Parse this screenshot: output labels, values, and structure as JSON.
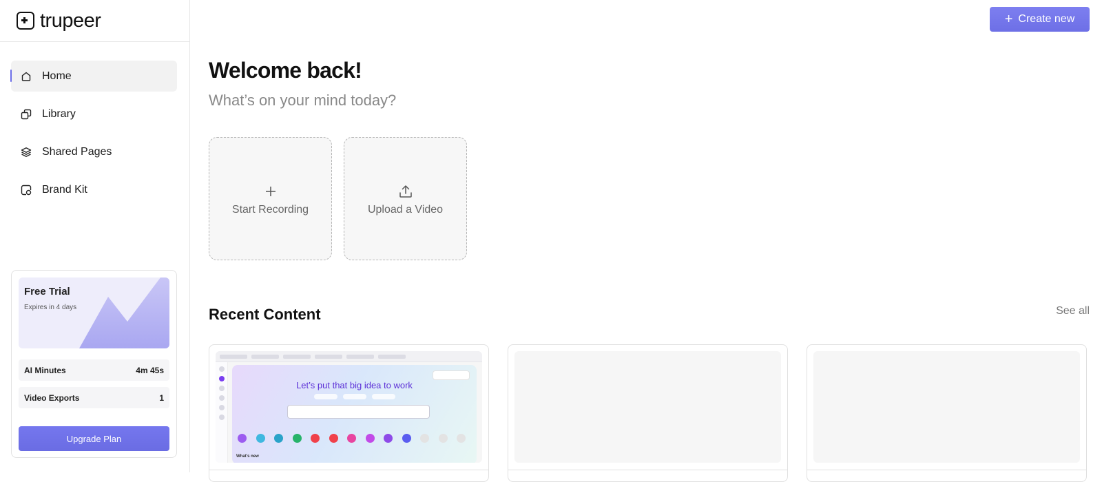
{
  "app": {
    "logo_text": "trupeer"
  },
  "sidebar": {
    "items": [
      {
        "label": "Home",
        "icon": "home-icon",
        "active": true
      },
      {
        "label": "Library",
        "icon": "library-icon",
        "active": false
      },
      {
        "label": "Shared Pages",
        "icon": "layers-icon",
        "active": false
      },
      {
        "label": "Brand Kit",
        "icon": "brand-kit-icon",
        "active": false
      }
    ],
    "trial": {
      "title": "Free Trial",
      "subtitle": "Expires in 4 days",
      "stats": [
        {
          "label": "AI Minutes",
          "value": "4m 45s"
        },
        {
          "label": "Video Exports",
          "value": "1"
        }
      ],
      "upgrade_label": "Upgrade Plan"
    }
  },
  "header": {
    "create_label": "Create new"
  },
  "main": {
    "welcome": "Welcome back!",
    "subtitle": "What’s on your mind today?",
    "actions": [
      {
        "label": "Start Recording",
        "icon": "plus-icon"
      },
      {
        "label": "Upload a Video",
        "icon": "upload-icon"
      }
    ],
    "recent_title": "Recent Content",
    "see_all": "See all",
    "thumbnail_headline": "Let’s put that big idea to work",
    "thumbnail_section": "What's new"
  },
  "colors": {
    "accent": "#6d6fe6",
    "active_bg": "#f2f2f2",
    "muted_text": "#888888"
  }
}
